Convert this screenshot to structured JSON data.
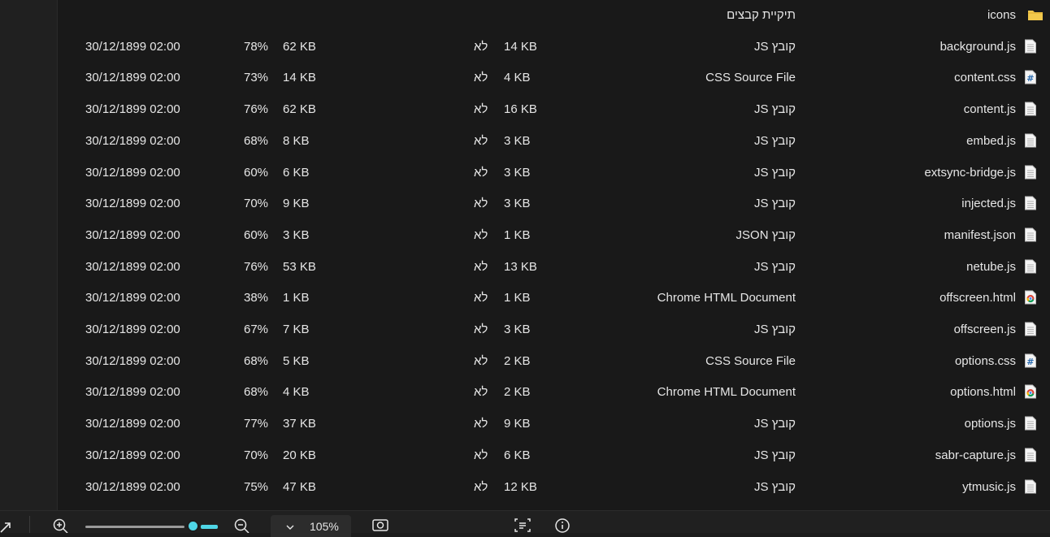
{
  "files": [
    {
      "name": "icons",
      "icon": "folder-icon",
      "type": "תיקיית קבצים",
      "packed": "",
      "protected": "",
      "size": "",
      "ratio": "",
      "modified": ""
    },
    {
      "name": "background.js",
      "icon": "js-file-icon",
      "type": "קובץ JS",
      "packed": "14 KB",
      "protected": "לא",
      "size": "62 KB",
      "ratio": "78%",
      "modified": "30/12/1899 02:00"
    },
    {
      "name": "content.css",
      "icon": "css-file-icon",
      "type": "CSS Source File",
      "packed": "4 KB",
      "protected": "לא",
      "size": "14 KB",
      "ratio": "73%",
      "modified": "30/12/1899 02:00"
    },
    {
      "name": "content.js",
      "icon": "js-file-icon",
      "type": "קובץ JS",
      "packed": "16 KB",
      "protected": "לא",
      "size": "62 KB",
      "ratio": "76%",
      "modified": "30/12/1899 02:00"
    },
    {
      "name": "embed.js",
      "icon": "js-file-icon",
      "type": "קובץ JS",
      "packed": "3 KB",
      "protected": "לא",
      "size": "8 KB",
      "ratio": "68%",
      "modified": "30/12/1899 02:00"
    },
    {
      "name": "extsync-bridge.js",
      "icon": "js-file-icon",
      "type": "קובץ JS",
      "packed": "3 KB",
      "protected": "לא",
      "size": "6 KB",
      "ratio": "60%",
      "modified": "30/12/1899 02:00"
    },
    {
      "name": "injected.js",
      "icon": "js-file-icon",
      "type": "קובץ JS",
      "packed": "3 KB",
      "protected": "לא",
      "size": "9 KB",
      "ratio": "70%",
      "modified": "30/12/1899 02:00"
    },
    {
      "name": "manifest.json",
      "icon": "json-file-icon",
      "type": "קובץ JSON",
      "packed": "1 KB",
      "protected": "לא",
      "size": "3 KB",
      "ratio": "60%",
      "modified": "30/12/1899 02:00"
    },
    {
      "name": "netube.js",
      "icon": "js-file-icon",
      "type": "קובץ JS",
      "packed": "13 KB",
      "protected": "לא",
      "size": "53 KB",
      "ratio": "76%",
      "modified": "30/12/1899 02:00"
    },
    {
      "name": "offscreen.html",
      "icon": "chrome-html-icon",
      "type": "Chrome HTML Document",
      "packed": "1 KB",
      "protected": "לא",
      "size": "1 KB",
      "ratio": "38%",
      "modified": "30/12/1899 02:00"
    },
    {
      "name": "offscreen.js",
      "icon": "js-file-icon",
      "type": "קובץ JS",
      "packed": "3 KB",
      "protected": "לא",
      "size": "7 KB",
      "ratio": "67%",
      "modified": "30/12/1899 02:00"
    },
    {
      "name": "options.css",
      "icon": "css-file-icon",
      "type": "CSS Source File",
      "packed": "2 KB",
      "protected": "לא",
      "size": "5 KB",
      "ratio": "68%",
      "modified": "30/12/1899 02:00"
    },
    {
      "name": "options.html",
      "icon": "chrome-html-icon",
      "type": "Chrome HTML Document",
      "packed": "2 KB",
      "protected": "לא",
      "size": "4 KB",
      "ratio": "68%",
      "modified": "30/12/1899 02:00"
    },
    {
      "name": "options.js",
      "icon": "js-file-icon",
      "type": "קובץ JS",
      "packed": "9 KB",
      "protected": "לא",
      "size": "37 KB",
      "ratio": "77%",
      "modified": "30/12/1899 02:00"
    },
    {
      "name": "sabr-capture.js",
      "icon": "js-file-icon",
      "type": "קובץ JS",
      "packed": "6 KB",
      "protected": "לא",
      "size": "20 KB",
      "ratio": "70%",
      "modified": "30/12/1899 02:00"
    },
    {
      "name": "ytmusic.js",
      "icon": "js-file-icon",
      "type": "קובץ JS",
      "packed": "12 KB",
      "protected": "לא",
      "size": "47 KB",
      "ratio": "75%",
      "modified": "30/12/1899 02:00"
    }
  ],
  "bottom_bar": {
    "zoom_value": "105%",
    "zoom_level": 0.89,
    "icons": [
      "expand-icon",
      "zoom-in-icon",
      "zoom-out-icon",
      "chevron-down-icon",
      "screenshot-icon",
      "text-recognition-icon",
      "info-icon"
    ]
  },
  "colors": {
    "background": "#191919",
    "accent": "#4fd6e6",
    "folder": "#f2c94c"
  }
}
